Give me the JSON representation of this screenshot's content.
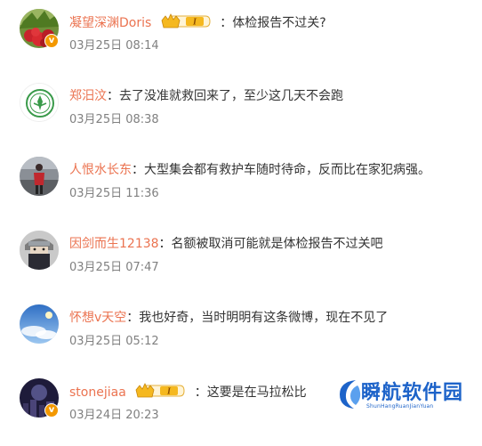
{
  "comments": [
    {
      "username": "凝望深渊Doris",
      "separator": "：",
      "text": "体检报告不过关?",
      "time": "03月25日 08:14",
      "verified": true,
      "level_badge": "I",
      "avatar_icon": "strawberry-avatar"
    },
    {
      "username": "郑汨汶",
      "separator": "：",
      "text": "去了没准就救回来了，至少这几天不会跑",
      "time": "03月25日 08:38",
      "verified": false,
      "avatar_icon": "green-emblem-avatar"
    },
    {
      "username": "人恨水长东",
      "separator": "：",
      "text": "大型集会都有救护车随时待命，反而比在家犯病强。",
      "time": "03月25日 11:36",
      "verified": false,
      "avatar_icon": "person-road-avatar"
    },
    {
      "username": "因剑而生12138",
      "separator": "：",
      "text": "名额被取消可能就是体检报告不过关吧",
      "time": "03月25日 07:47",
      "verified": false,
      "avatar_icon": "masked-ninja-avatar"
    },
    {
      "username": "怀想v天空",
      "separator": "：",
      "text": "我也好奇，当时明明有这条微博，现在不见了",
      "time": "03月25日 05:12",
      "verified": false,
      "avatar_icon": "blue-sky-avatar"
    },
    {
      "username": "stonejiaa",
      "separator": "：",
      "text": "这要是在马拉松比",
      "time": "03月24日 20:23",
      "verified": true,
      "level_badge": "I",
      "avatar_icon": "night-city-avatar"
    }
  ],
  "watermark": {
    "title": "瞬航软件园",
    "subtitle": "ShunHangRuanJianYuan"
  },
  "colors": {
    "username": "#eb7350",
    "text": "#333333",
    "time": "#808080",
    "verified": "#f39800",
    "watermark": "#1d63c9"
  }
}
